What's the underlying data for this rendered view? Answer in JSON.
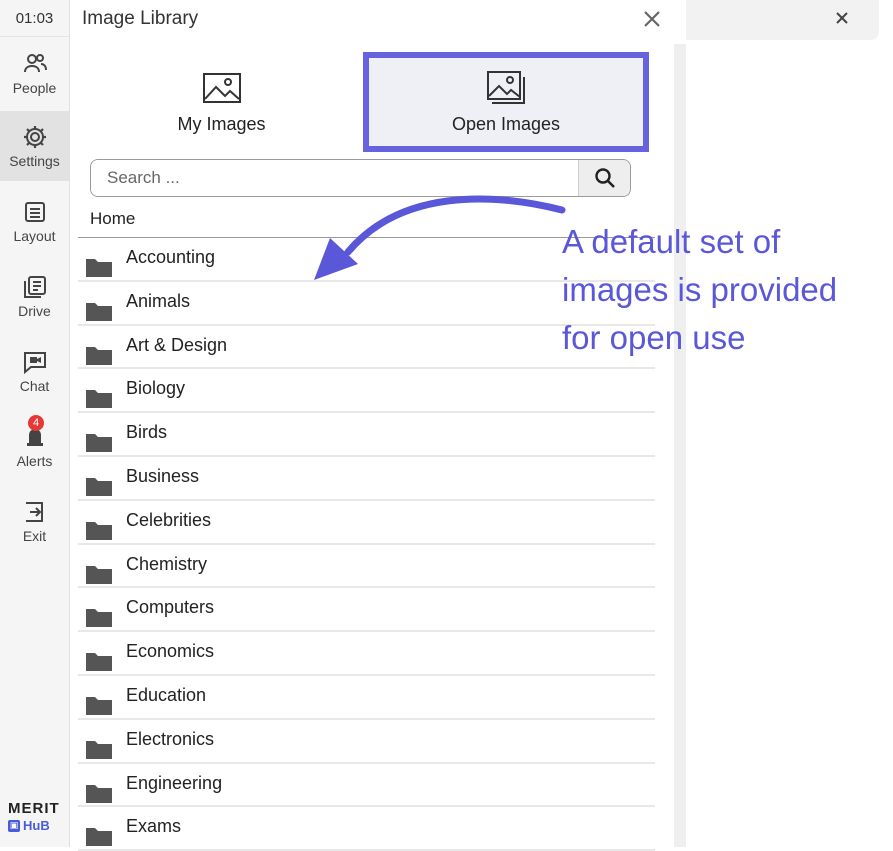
{
  "rail": {
    "clock": "01:03",
    "items": [
      {
        "label": "People",
        "icon": "people-icon"
      },
      {
        "label": "Settings",
        "icon": "gear-icon"
      },
      {
        "label": "Layout",
        "icon": "layout-icon"
      },
      {
        "label": "Drive",
        "icon": "drive-icon"
      },
      {
        "label": "Chat",
        "icon": "chat-icon"
      },
      {
        "label": "Alerts",
        "icon": "bell-icon",
        "badge": "4"
      },
      {
        "label": "Exit",
        "icon": "exit-icon"
      }
    ],
    "logo_top": "MERIT",
    "logo_bottom": "HuB"
  },
  "panel": {
    "title": "Image Library",
    "tabs": [
      {
        "label": "My Images",
        "icon": "image-icon"
      },
      {
        "label": "Open Images",
        "icon": "images-stack-icon",
        "selected": true
      }
    ],
    "search": {
      "placeholder": "Search ...",
      "value": ""
    },
    "breadcrumb": "Home",
    "folders": [
      "Accounting",
      "Animals",
      "Art & Design",
      "Biology",
      "Birds",
      "Business",
      "Celebrities",
      "Chemistry",
      "Computers",
      "Economics",
      "Education",
      "Electronics",
      "Engineering",
      "Exams"
    ]
  },
  "annotation": {
    "text_lines": [
      "A default set of",
      "images is provided",
      "for open use"
    ],
    "color": "#5a57d8"
  },
  "colors": {
    "highlight_border": "#6762e0",
    "badge": "#e53935",
    "folder_icon": "#555555"
  }
}
